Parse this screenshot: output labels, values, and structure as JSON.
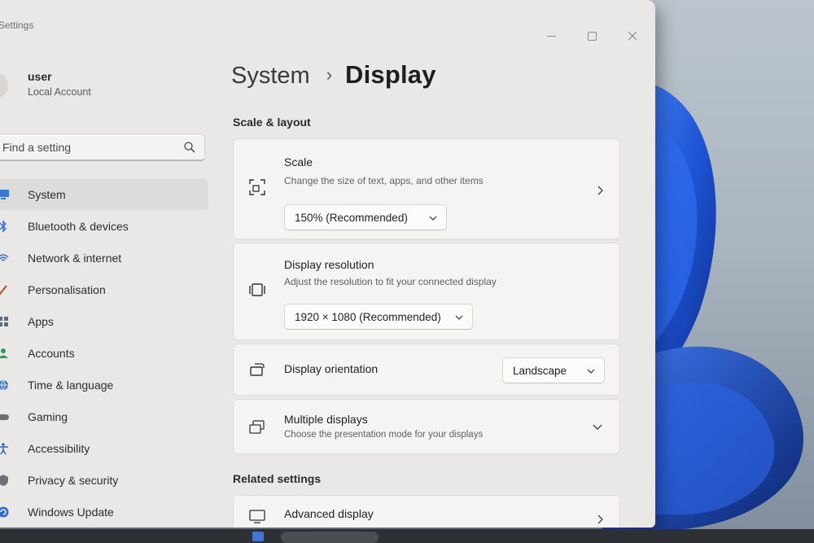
{
  "window": {
    "app_title": "Settings"
  },
  "account": {
    "name": "user",
    "type": "Local Account"
  },
  "search": {
    "placeholder": "Find a setting"
  },
  "sidebar": {
    "items": [
      {
        "label": "System",
        "icon": "monitor-icon",
        "selected": true
      },
      {
        "label": "Bluetooth & devices",
        "icon": "bluetooth-icon"
      },
      {
        "label": "Network & internet",
        "icon": "network-icon"
      },
      {
        "label": "Personalisation",
        "icon": "brush-icon"
      },
      {
        "label": "Apps",
        "icon": "apps-icon"
      },
      {
        "label": "Accounts",
        "icon": "accounts-icon"
      },
      {
        "label": "Time & language",
        "icon": "globe-icon"
      },
      {
        "label": "Gaming",
        "icon": "gamepad-icon"
      },
      {
        "label": "Accessibility",
        "icon": "accessibility-icon"
      },
      {
        "label": "Privacy & security",
        "icon": "shield-icon"
      },
      {
        "label": "Windows Update",
        "icon": "update-icon"
      }
    ]
  },
  "breadcrumb": {
    "parent": "System",
    "separator": "›",
    "current": "Display"
  },
  "sections": {
    "scale_layout": "Scale & layout",
    "related": "Related settings"
  },
  "cards": {
    "scale": {
      "title": "Scale",
      "description": "Change the size of text, apps, and other items",
      "value": "150% (Recommended)"
    },
    "resolution": {
      "title": "Display resolution",
      "description": "Adjust the resolution to fit your connected display",
      "value": "1920 × 1080 (Recommended)"
    },
    "orientation": {
      "title": "Display orientation",
      "value": "Landscape"
    },
    "multiple": {
      "title": "Multiple displays",
      "description": "Choose the presentation mode for your displays"
    },
    "advanced": {
      "title": "Advanced display"
    }
  },
  "colors": {
    "window_bg": "#e9e8e6",
    "card_bg": "#f4f4f3",
    "wallpaper_accent": "#1f55d6"
  }
}
